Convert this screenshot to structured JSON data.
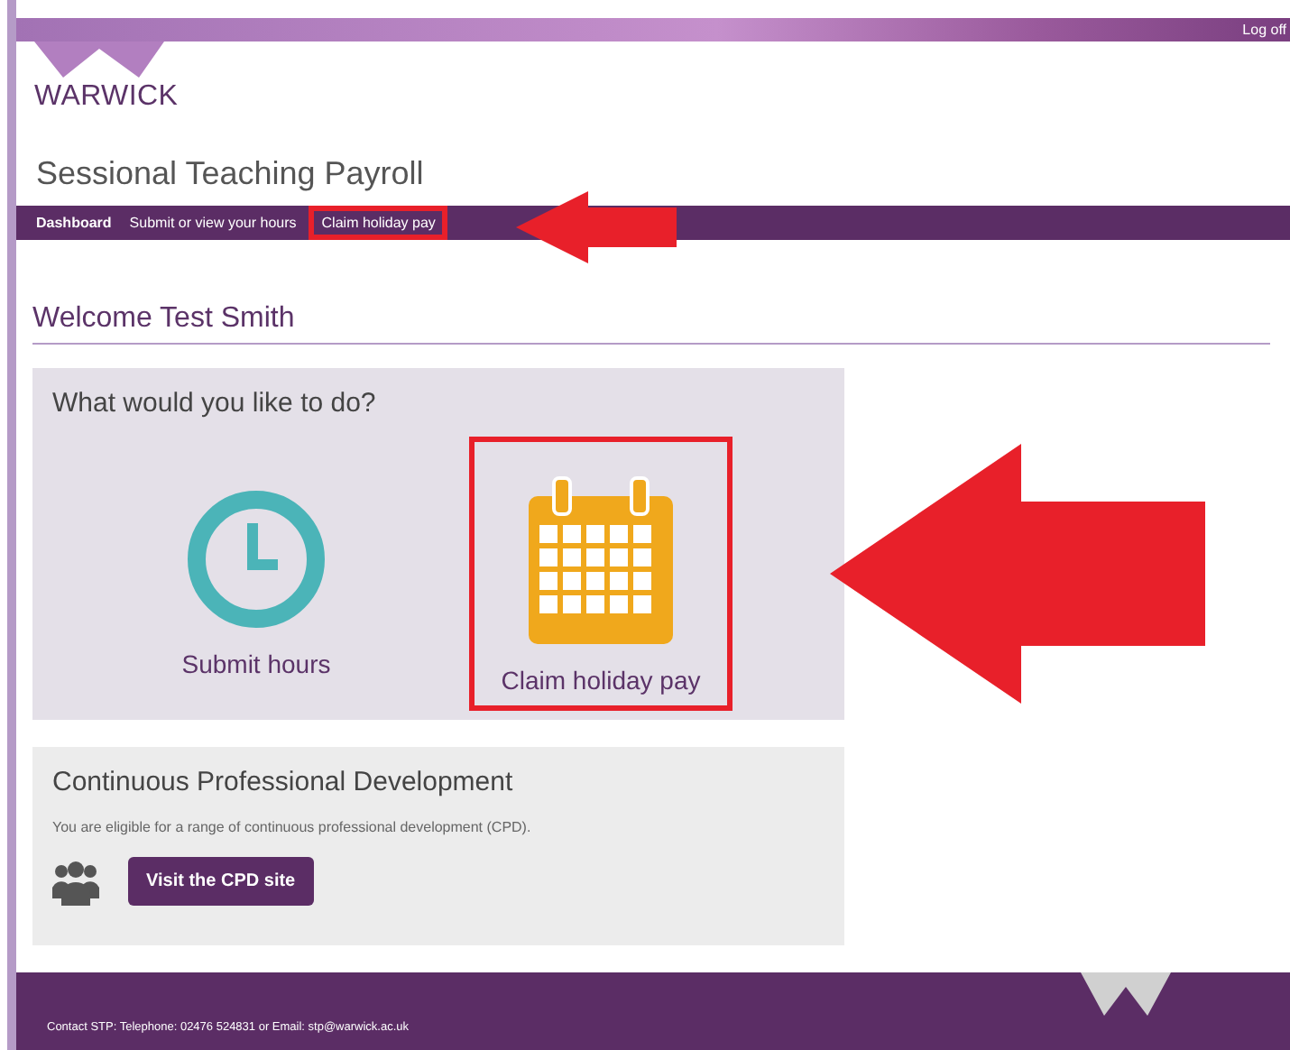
{
  "top_bar": {
    "logoff": "Log off"
  },
  "logo": {
    "text": "WARWICK"
  },
  "site_title": "Sessional Teaching Payroll",
  "nav": [
    {
      "label": "Dashboard",
      "selected": true,
      "highlighted": false
    },
    {
      "label": "Submit or view your hours",
      "selected": false,
      "highlighted": false
    },
    {
      "label": "Claim holiday pay",
      "selected": false,
      "highlighted": true
    }
  ],
  "welcome": "Welcome Test Smith",
  "actions": {
    "heading": "What would you like to do?",
    "items": [
      {
        "kind": "clock",
        "label": "Submit hours",
        "highlighted": false
      },
      {
        "kind": "calendar",
        "label": "Claim holiday pay",
        "highlighted": true
      }
    ]
  },
  "cpd": {
    "heading": "Continuous Professional Development",
    "text": "You are eligible for a range of continuous professional development (CPD).",
    "button": "Visit the CPD site"
  },
  "footer": {
    "contact": "Contact STP: Telephone: 02476 524831 or Email: stp@warwick.ac.uk"
  }
}
